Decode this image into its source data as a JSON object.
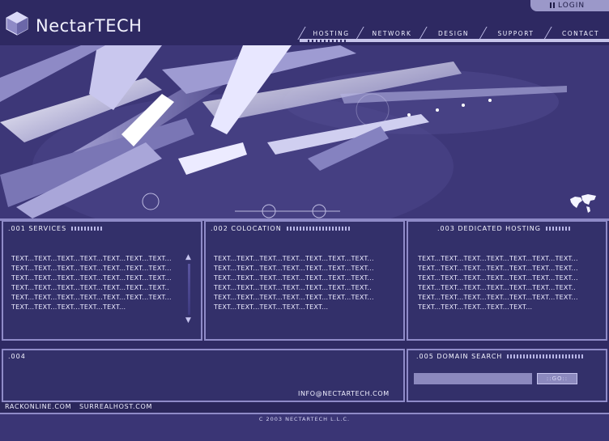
{
  "brand": {
    "name": "NectarTECH"
  },
  "header": {
    "login_label": "LOGIN",
    "nav": [
      "HOSTING",
      "NETWORK",
      "DESIGN",
      "SUPPORT",
      "CONTACT"
    ]
  },
  "panels": {
    "services": {
      "title": ".001 SERVICES",
      "text": "TEXT...TEXT...TEXT...TEXT...TEXT...TEXT...TEXT...\nTEXT...TEXT...TEXT...TEXT...TEXT...TEXT...TEXT...\nTEXT...TEXT...TEXT...TEXT...TEXT...TEXT...TEXT...\nTEXT...TEXT...TEXT...TEXT...TEXT...TEXT...TEXT..\nTEXT...TEXT...TEXT...TEXT...TEXT...TEXT...TEXT...\nTEXT...TEXT...TEXT...TEXT...TEXT..."
    },
    "colocation": {
      "title": ".002 COLOCATION",
      "text": "TEXT...TEXT...TEXT...TEXT...TEXT...TEXT...TEXT...\nTEXT...TEXT...TEXT...TEXT...TEXT...TEXT...TEXT...\nTEXT...TEXT...TEXT...TEXT...TEXT...TEXT...TEXT...\nTEXT...TEXT...TEXT...TEXT...TEXT...TEXT...TEXT..\nTEXT...TEXT...TEXT...TEXT...TEXT...TEXT...TEXT...\nTEXT...TEXT...TEXT...TEXT...TEXT..."
    },
    "dedicated": {
      "title": ".003 DEDICATED HOSTING",
      "text": "TEXT...TEXT...TEXT...TEXT...TEXT...TEXT...TEXT...\nTEXT...TEXT...TEXT...TEXT...TEXT...TEXT...TEXT...\nTEXT...TEXT...TEXT...TEXT...TEXT...TEXT...TEXT...\nTEXT...TEXT...TEXT...TEXT...TEXT...TEXT...TEXT..\nTEXT...TEXT...TEXT...TEXT...TEXT...TEXT...TEXT...\nTEXT...TEXT...TEXT...TEXT...TEXT..."
    },
    "p004": {
      "title": ".004",
      "email": "INFO@NECTARTECH.COM"
    },
    "domain": {
      "title": ".005 DOMAIN SEARCH",
      "go_label": "::GO::"
    }
  },
  "footer": {
    "links": [
      "RACKONLINE.COM",
      "SURREALHOST.COM"
    ],
    "copyright": "C 2003 NECTARTECH L.L.C."
  },
  "colors": {
    "background": "#2f2a63",
    "panel": "#33306a",
    "border": "#8f8bc8",
    "accent": "#c6c4ea"
  },
  "icons": [
    "logo-cube-icon",
    "login-grid-icon",
    "world-map-icon",
    "scroll-up-arrow-icon",
    "scroll-down-arrow-icon"
  ]
}
